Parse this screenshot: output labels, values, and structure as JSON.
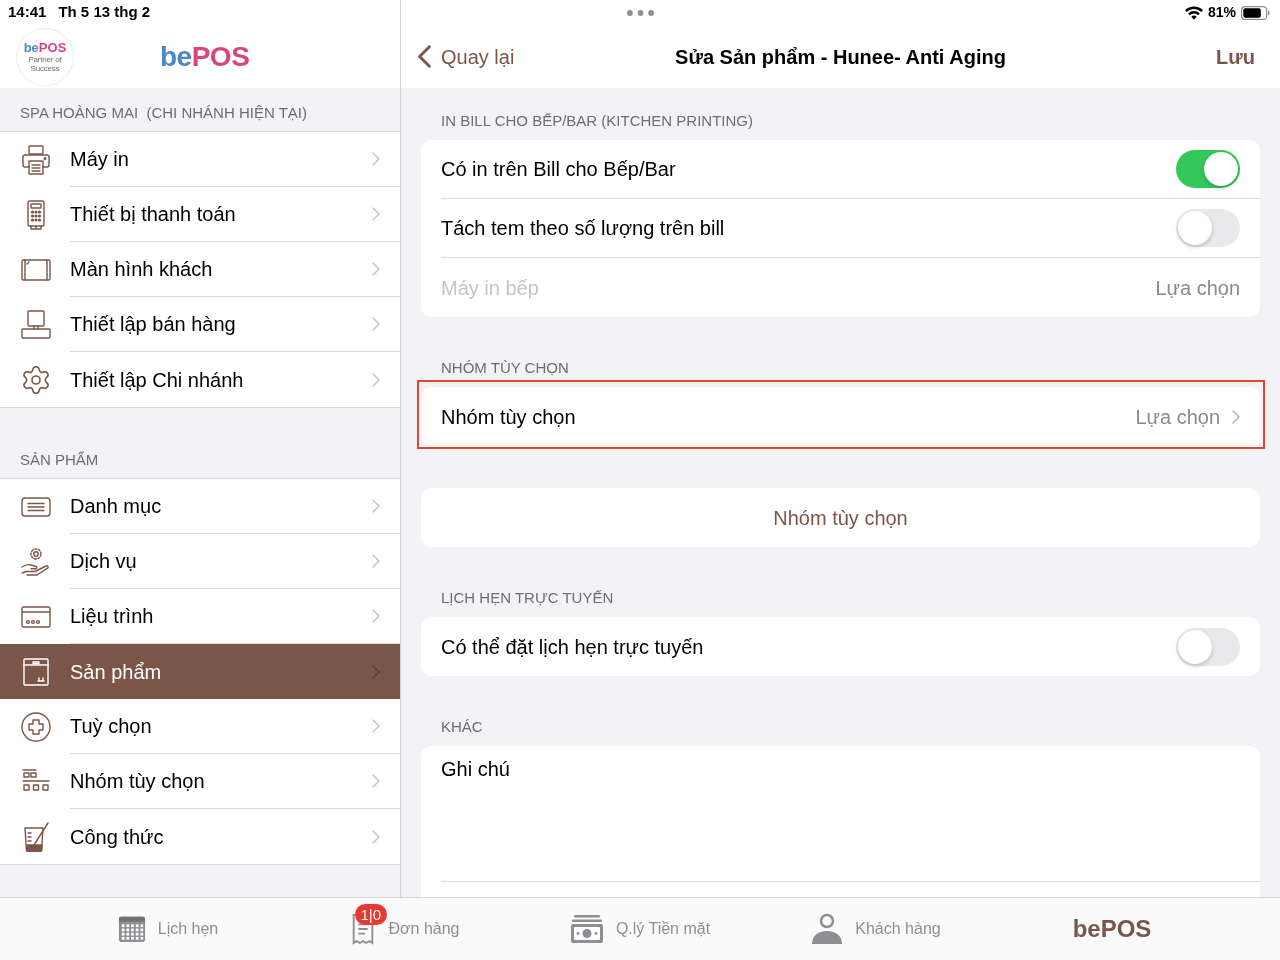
{
  "status_bar": {
    "time": "14:41",
    "date": "Th 5 13 thg 2",
    "battery": "81%"
  },
  "sidebar": {
    "logo": {
      "wordmark_part_1": "be",
      "wordmark_part_2": "POS",
      "tagline": "Partner of Success"
    },
    "brand": {
      "part_1": "be",
      "part_2": "POS"
    },
    "sections": [
      {
        "header": "SPA HOÀNG MAI  (CHI NHÁNH HIỆN TẠI)",
        "items": [
          {
            "label": "Máy in",
            "selected": false
          },
          {
            "label": "Thiết bị thanh toán",
            "selected": false
          },
          {
            "label": "Màn hình khách",
            "selected": false
          },
          {
            "label": "Thiết lập bán hàng",
            "selected": false
          },
          {
            "label": "Thiết lập Chi nhánh",
            "selected": false
          }
        ]
      },
      {
        "header": "SẢN PHẨM",
        "items": [
          {
            "label": "Danh mục",
            "selected": false
          },
          {
            "label": "Dịch vụ",
            "selected": false
          },
          {
            "label": "Liệu trình",
            "selected": false
          },
          {
            "label": "Sản phẩm",
            "selected": true
          },
          {
            "label": "Tuỳ chọn",
            "selected": false
          },
          {
            "label": "Nhóm tùy chọn",
            "selected": false
          },
          {
            "label": "Công thức",
            "selected": false
          }
        ]
      }
    ]
  },
  "detail": {
    "nav": {
      "back": "Quay lại",
      "title": "Sửa Sản phẩm - Hunee- Anti Aging",
      "action": "Lưu"
    },
    "sections": [
      {
        "header": "IN BILL CHO BẾP/BAR (KITCHEN PRINTING)",
        "highlighted": false,
        "rows": [
          {
            "kind": "toggle",
            "label": "Có in trên Bill cho Bếp/Bar",
            "on": true
          },
          {
            "kind": "toggle",
            "label": "Tách tem theo số lượng trên bill",
            "on": false
          },
          {
            "kind": "select",
            "label": "Máy in bếp",
            "value": "Lựa chọn",
            "disabled": true
          }
        ]
      },
      {
        "header": "NHÓM TÙY CHỌN",
        "highlighted": true,
        "rows": [
          {
            "kind": "select",
            "label": "Nhóm tùy chọn",
            "value": "Lựa chọn",
            "disabled": false
          }
        ]
      },
      {
        "highlighted": false,
        "rows": [
          {
            "kind": "action",
            "label": "Nhóm tùy chọn"
          }
        ]
      },
      {
        "header": "LỊCH HẸN TRỰC TUYẾN",
        "highlighted": false,
        "rows": [
          {
            "kind": "toggle",
            "label": "Có thể đặt lịch hẹn trực tuyến",
            "on": false
          }
        ]
      },
      {
        "header": "KHÁC",
        "highlighted": false,
        "rows": [
          {
            "kind": "note",
            "label": "Ghi chú"
          }
        ]
      }
    ]
  },
  "tab_bar": [
    {
      "kind": "icon",
      "label": "Lịch hẹn",
      "selected": false
    },
    {
      "kind": "icon",
      "label": "Đơn hàng",
      "badge": "1|0",
      "selected": false
    },
    {
      "kind": "icon",
      "label": "Q.lý Tiền mặt",
      "selected": false
    },
    {
      "kind": "icon",
      "label": "Khách hàng",
      "selected": false
    },
    {
      "kind": "brand",
      "label": "bePOS",
      "selected": true
    }
  ]
}
